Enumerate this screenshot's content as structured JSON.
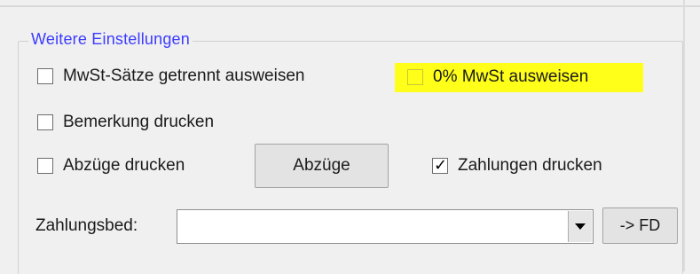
{
  "group": {
    "title": "Weitere Einstellungen"
  },
  "options": {
    "mwst_getrennt": {
      "label": "MwSt-Sätze getrennt ausweisen",
      "checked": false
    },
    "null_mwst": {
      "label": "0% MwSt ausweisen",
      "checked": false,
      "highlight_color": "#ffff1a"
    },
    "bemerkung": {
      "label": "Bemerkung drucken",
      "checked": false
    },
    "abzuege_drucken": {
      "label": "Abzüge drucken",
      "checked": false
    },
    "zahlungen_drucken": {
      "label": "Zahlungen drucken",
      "checked": true
    }
  },
  "buttons": {
    "abzuege": "Abzüge",
    "fd": "-> FD"
  },
  "zahlungsbed": {
    "label": "Zahlungsbed:",
    "value": ""
  },
  "colors": {
    "legend": "#3c3cff",
    "highlight": "#ffff1a"
  },
  "icons": {
    "check": "checkmark-icon",
    "dropdown": "chevron-down-icon"
  }
}
